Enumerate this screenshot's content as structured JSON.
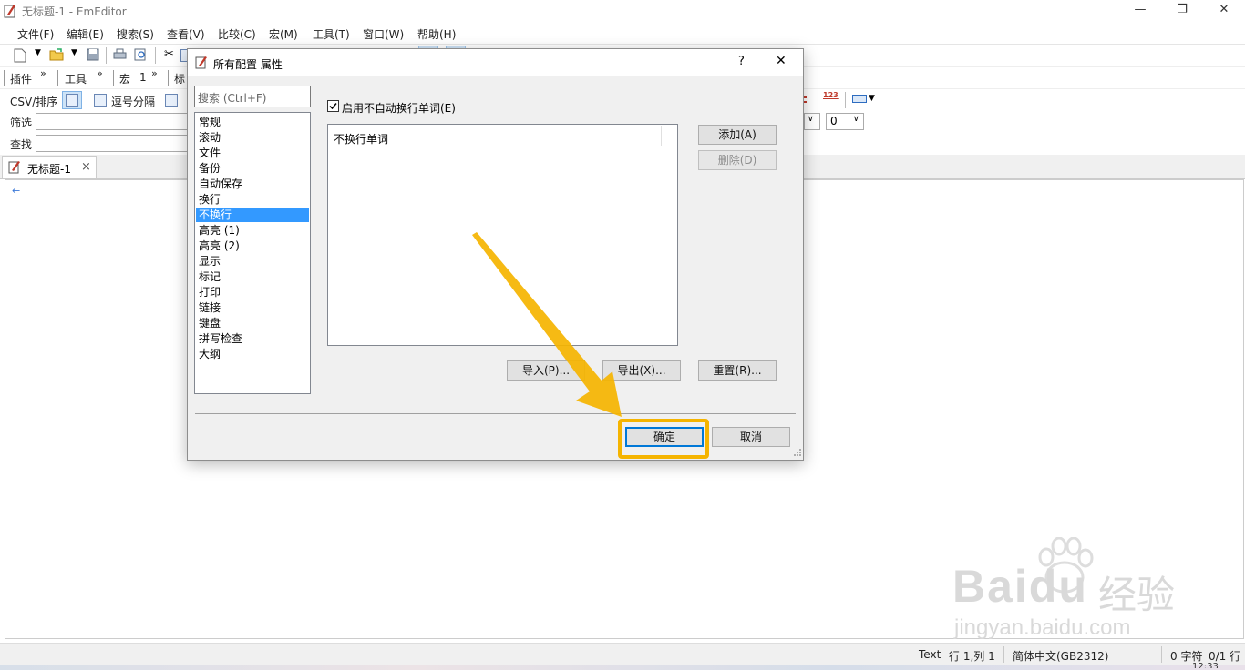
{
  "window": {
    "title": "无标题-1 - EmEditor",
    "minimize_glyph": "—",
    "restore_glyph": "❐",
    "close_glyph": "✕"
  },
  "menu": [
    "文件(F)",
    "编辑(E)",
    "搜索(S)",
    "查看(V)",
    "比较(C)",
    "宏(M)",
    "工具(T)",
    "窗口(W)",
    "帮助(H)"
  ],
  "toolbars": {
    "plugins_label": "插件",
    "tools_label": "工具",
    "macros_label": "宏",
    "macros_extra": "1",
    "markers_label": "标",
    "overflow_glyph": "»",
    "csv_label": "CSV/排序",
    "comma_label": "逗号分隔",
    "filter_label": "筛选",
    "find_label": "查找",
    "column_select_value": "0",
    "numbers_icon_text": "123"
  },
  "tabs": [
    {
      "label": "无标题-1",
      "close": "×"
    }
  ],
  "editor": {
    "eol_marker": "←"
  },
  "statusbar": {
    "mode": "Text",
    "position": "行 1,列 1",
    "encoding": "简体中文(GB2312)",
    "chars": "0 字符",
    "lines": "0/1 行",
    "clock_partial": "12:33"
  },
  "dialog": {
    "title": "所有配置 属性",
    "help_glyph": "?",
    "close_glyph": "✕",
    "search_placeholder": "搜索 (Ctrl+F)",
    "categories": [
      "常规",
      "滚动",
      "文件",
      "备份",
      "自动保存",
      "换行",
      "不换行",
      "高亮 (1)",
      "高亮 (2)",
      "显示",
      "标记",
      "打印",
      "链接",
      "键盘",
      "拼写检查",
      "大纲"
    ],
    "selected_category": "不换行",
    "checkbox_label": "启用不自动换行单词(E)",
    "checkbox_checked": true,
    "list_header": "不换行单词",
    "add_button": "添加(A)",
    "delete_button": "删除(D)",
    "import_button": "导入(P)...",
    "export_button": "导出(X)...",
    "reset_button": "重置(R)...",
    "ok_button": "确定",
    "cancel_button": "取消"
  },
  "annotation": {
    "highlight_color": "#f5b400",
    "arrow_color": "#f5b400"
  },
  "watermark": {
    "brand": "Baidu",
    "brand_cn": "经验",
    "url": "jingyan.baidu.com"
  }
}
